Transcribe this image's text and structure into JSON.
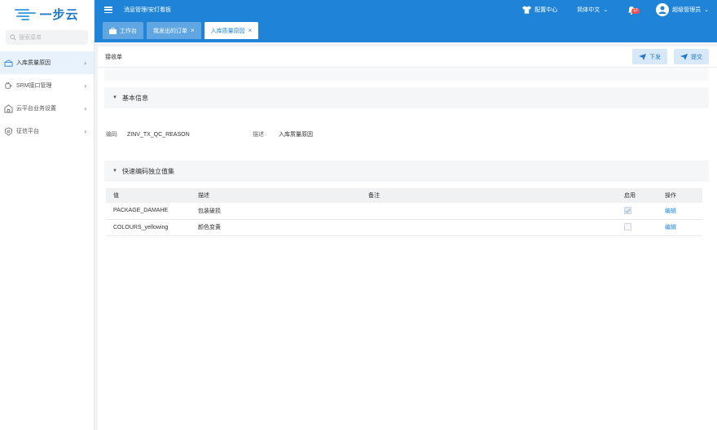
{
  "app": {
    "logo_text": "一步云"
  },
  "sidebar": {
    "search_placeholder": "搜索菜单",
    "items": [
      {
        "label": "入库质量原因",
        "icon": "box-icon",
        "active": true
      },
      {
        "label": "SRM接口管理",
        "icon": "plug-icon",
        "active": false
      },
      {
        "label": "云平台业务设置",
        "icon": "building-icon",
        "active": false
      },
      {
        "label": "征信平台",
        "icon": "shield-icon",
        "active": false
      }
    ]
  },
  "header": {
    "breadcrumb": "消息管理/安灯看板",
    "config_center": "配置中心",
    "language": "简体中文",
    "notification_count": "12",
    "user": "超级管理员"
  },
  "tabs": [
    {
      "label": "工作台",
      "closable": false,
      "active": false
    },
    {
      "label": "我发出的订单",
      "closable": true,
      "active": false
    },
    {
      "label": "入库质量原因",
      "closable": true,
      "active": true
    }
  ],
  "toolbar": {
    "title": "接收单",
    "issue_label": "下发",
    "submit_label": "提交"
  },
  "basic_info": {
    "section_title": "基本信息",
    "code_label": "编码",
    "code_value": "ZINV_TX_QC_REASON",
    "desc_label": "描述",
    "desc_value": "入库质量原因"
  },
  "value_set": {
    "section_title": "快速编码独立值集",
    "columns": {
      "value": "值",
      "desc": "描述",
      "remark": "备注",
      "enabled": "启用",
      "action": "操作"
    },
    "rows": [
      {
        "value": "PACKAGE_DAMAHE",
        "desc": "包装破损",
        "remark": "",
        "enabled": true,
        "action": "编辑"
      },
      {
        "value": "COLOURS_yellowing",
        "desc": "颜色变黄",
        "remark": "",
        "enabled": false,
        "action": "编辑"
      }
    ]
  },
  "colors": {
    "primary": "#1f84d8",
    "sidebar_active": "#e8f2fc"
  }
}
